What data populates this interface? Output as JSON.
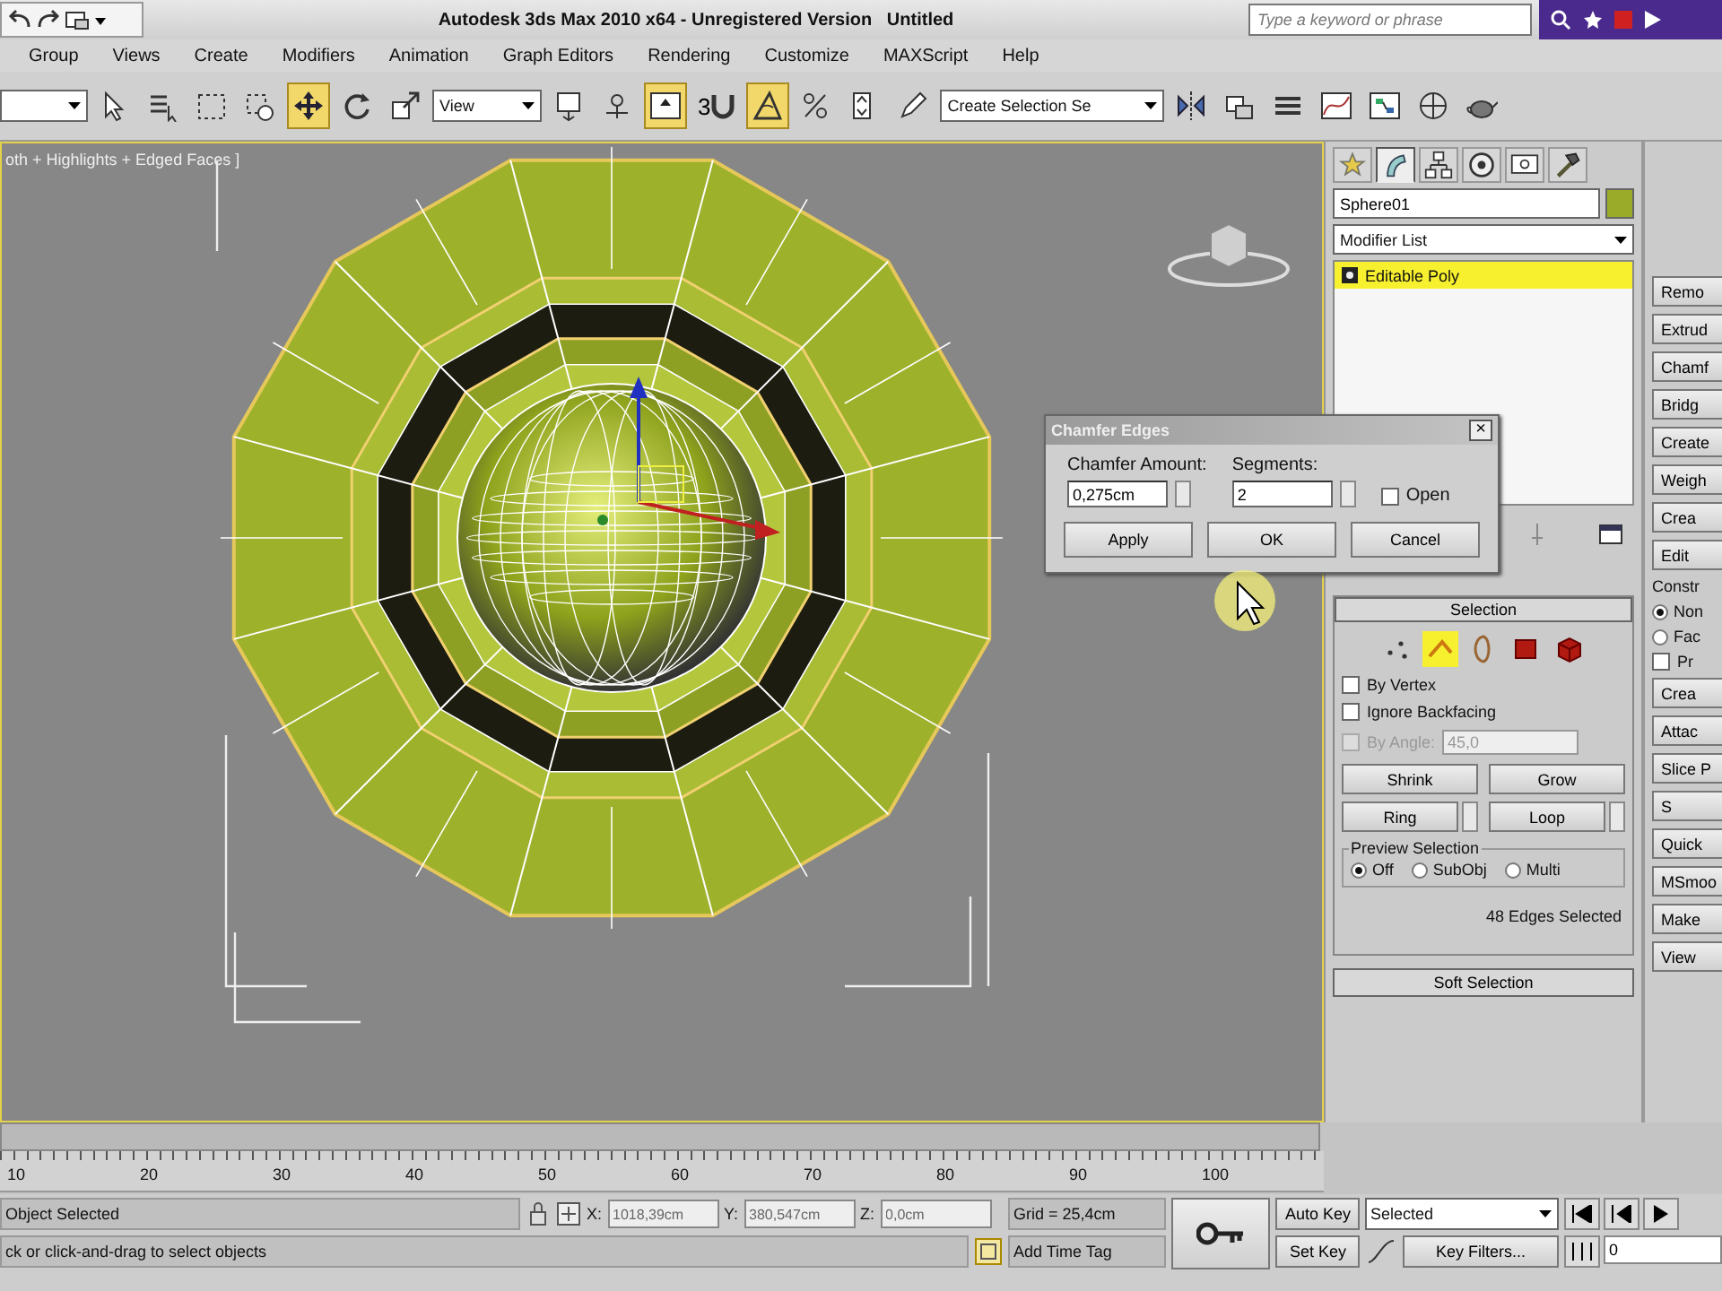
{
  "title_bar": {
    "title": "Autodesk 3ds Max 2010 x64 - Unregistered Version   Untitled",
    "search": {
      "placeholder": "Type a keyword or phrase"
    }
  },
  "menu": [
    "Group",
    "Views",
    "Create",
    "Modifiers",
    "Animation",
    "Graph Editors",
    "Rendering",
    "Customize",
    "MAXScript",
    "Help"
  ],
  "toolbar": [
    {
      "kind": "combo"
    },
    {
      "kind": "cursor",
      "active": false
    },
    {
      "kind": "list",
      "active": false
    },
    {
      "kind": "region",
      "active": false
    },
    {
      "kind": "window",
      "active": false
    },
    {
      "kind": "move",
      "active": true
    },
    {
      "kind": "rotate",
      "active": false
    },
    {
      "kind": "scale",
      "active": false
    },
    {
      "kind": "combo",
      "value": "View"
    },
    {
      "kind": "pivot",
      "active": false
    },
    {
      "kind": "manipulate",
      "active": false
    },
    {
      "kind": "keyboard",
      "active": true
    },
    {
      "kind": "snap",
      "label": "3",
      "active": false
    },
    {
      "kind": "angle",
      "active": true
    },
    {
      "kind": "percent",
      "active": false
    },
    {
      "kind": "spinner",
      "active": false
    },
    {
      "kind": "named",
      "active": false
    },
    {
      "kind": "combo",
      "value": "Create Selection Se"
    },
    {
      "kind": "mirror",
      "active": false
    },
    {
      "kind": "align",
      "active": false
    },
    {
      "kind": "layers",
      "active": false
    },
    {
      "kind": "curve",
      "active": false
    },
    {
      "kind": "schematic",
      "active": false
    },
    {
      "kind": "material",
      "active": false
    },
    {
      "kind": "render",
      "active": false
    }
  ],
  "viewport": {
    "label": "oth + Highlights + Edged Faces ]"
  },
  "dialog": {
    "title": "Chamfer Edges",
    "close": "×",
    "fields": [
      {
        "label": "Chamfer Amount:",
        "value": "0,275cm"
      },
      {
        "label": "Segments:",
        "value": "2"
      }
    ],
    "open": {
      "label": "Open",
      "checked": false
    },
    "buttons": [
      "Apply",
      "OK",
      "Cancel"
    ]
  },
  "command_panel": {
    "tabs": [
      {
        "kind": "create",
        "selected": false
      },
      {
        "kind": "modify",
        "selected": true
      },
      {
        "kind": "hierarchy",
        "selected": false
      },
      {
        "kind": "motion",
        "selected": false
      },
      {
        "kind": "display",
        "selected": false
      },
      {
        "kind": "utilities",
        "selected": false
      }
    ],
    "object_name": "Sphere01",
    "modifier_list": "Modifier List",
    "stack": [
      {
        "label": "Editable Poly",
        "selected": true
      }
    ],
    "selection": {
      "title": "Selection",
      "subobjects": [
        {
          "kind": "vertex",
          "selected": false
        },
        {
          "kind": "edge",
          "selected": true
        },
        {
          "kind": "border",
          "selected": false
        },
        {
          "kind": "polygon",
          "selected": false
        },
        {
          "kind": "element",
          "selected": false
        }
      ],
      "checks": [
        {
          "label": "By Vertex",
          "checked": false,
          "disabled": false
        },
        {
          "label": "Ignore Backfacing",
          "checked": false,
          "disabled": false
        },
        {
          "label": "By Angle:",
          "checked": false,
          "disabled": true,
          "value": "45,0"
        }
      ],
      "buttons": [
        {
          "label": "Shrink",
          "spinner": false
        },
        {
          "label": "Grow",
          "spinner": false
        },
        {
          "label": "Ring",
          "spinner": true
        },
        {
          "label": "Loop",
          "spinner": true
        }
      ],
      "preview": {
        "title": "Preview Selection",
        "options": [
          {
            "label": "Off",
            "selected": true
          },
          {
            "label": "SubObj",
            "selected": false
          },
          {
            "label": "Multi",
            "selected": false
          }
        ]
      },
      "status": "48 Edges Selected"
    },
    "soft_selection": "Soft Selection"
  },
  "right_strip": [
    {
      "kind": "button",
      "label": "Remo"
    },
    {
      "kind": "button",
      "label": "Extrud"
    },
    {
      "kind": "button",
      "label": "Chamf"
    },
    {
      "kind": "button",
      "label": "Bridg"
    },
    {
      "kind": "button",
      "label": "Create"
    },
    {
      "kind": "button",
      "label": "Weigh"
    },
    {
      "kind": "button",
      "label": "Crea"
    },
    {
      "kind": "button",
      "label": "Edit"
    },
    {
      "kind": "label",
      "label": "Constr"
    },
    {
      "kind": "radio",
      "label": "Non",
      "selected": true
    },
    {
      "kind": "radio",
      "label": "Fac",
      "selected": false
    },
    {
      "kind": "check",
      "label": "Pr",
      "checked": false
    },
    {
      "kind": "button",
      "label": "Crea"
    },
    {
      "kind": "button",
      "label": "Attac"
    },
    {
      "kind": "button",
      "label": "Slice P"
    },
    {
      "kind": "button",
      "label": "S"
    },
    {
      "kind": "button",
      "label": "Quick"
    },
    {
      "kind": "button",
      "label": "MSmoo"
    },
    {
      "kind": "button",
      "label": "Make"
    },
    {
      "kind": "button",
      "label": "View"
    }
  ],
  "timeline": {
    "ticks": [
      "10",
      "20",
      "30",
      "40",
      "50",
      "60",
      "70",
      "80",
      "90",
      "100"
    ]
  },
  "status_bar": {
    "selection": "Object Selected",
    "prompt": "ck or click-and-drag to select objects",
    "x_label": "X:",
    "x": "1018,39cm",
    "y_label": "Y:",
    "y": "380,547cm",
    "z_label": "Z:",
    "z": "0,0cm",
    "grid": "Grid = 25,4cm",
    "add_time_tag": "Add Time Tag",
    "auto_key": "Auto Key",
    "set_key": "Set Key",
    "key_mode": "Selected",
    "key_filters": "Key Filters...",
    "frame": "0"
  }
}
